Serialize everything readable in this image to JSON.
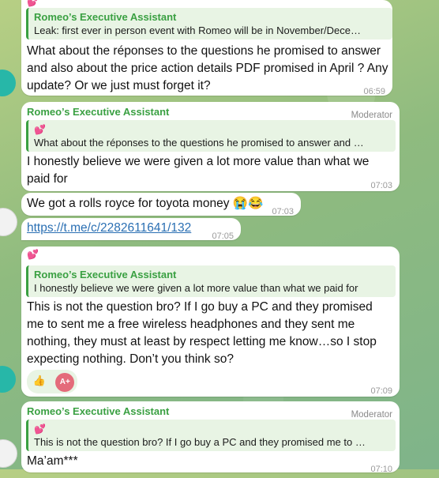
{
  "messages": [
    {
      "reply_sender": "Romeo’s Executive Assistant",
      "reply_text": "Leak: first ever in person event with Romeo will be in November/Dece…",
      "text": "What about the réponses to the questions he promised to answer and also about the price action details PDF promised in April ? Any update? Or we just must forget it?",
      "time": "06:59"
    },
    {
      "sender": "Romeo’s Executive Assistant",
      "role": "Moderator",
      "reply_text": "What about the réponses to the questions he promised to answer and …",
      "text": "I honestly believe we were given a lot more value than what we paid for",
      "time": "07:03"
    },
    {
      "text": "We got a rolls royce for toyota money 😭😂",
      "time": "07:03"
    },
    {
      "link": "https://t.me/c/2282611641/132",
      "time": "07:05"
    },
    {
      "reply_sender": "Romeo’s Executive Assistant",
      "reply_text": "I honestly believe we were given a lot more value than what we paid for",
      "text": "This is not the question bro? If I go buy a PC and they promised me to sent me a free wireless headphones  and they sent me nothing, they must at least by respect letting me know…so I stop expecting nothing. Don’t you think so?",
      "time": "07:09",
      "reactions": [
        "👍",
        "A+"
      ]
    },
    {
      "sender": "Romeo’s Executive Assistant",
      "role": "Moderator",
      "reply_text": "This is not the question bro? If I go buy a PC and they promised me to …",
      "text": "Ma’am***",
      "time": "07:10"
    }
  ],
  "colors": {
    "accent": "#3aa042",
    "link": "#2a6fb3",
    "heart": "#e4398a"
  },
  "icons": [
    "heart-emoji-icon",
    "thumbs-up-icon",
    "sticker-icon"
  ]
}
